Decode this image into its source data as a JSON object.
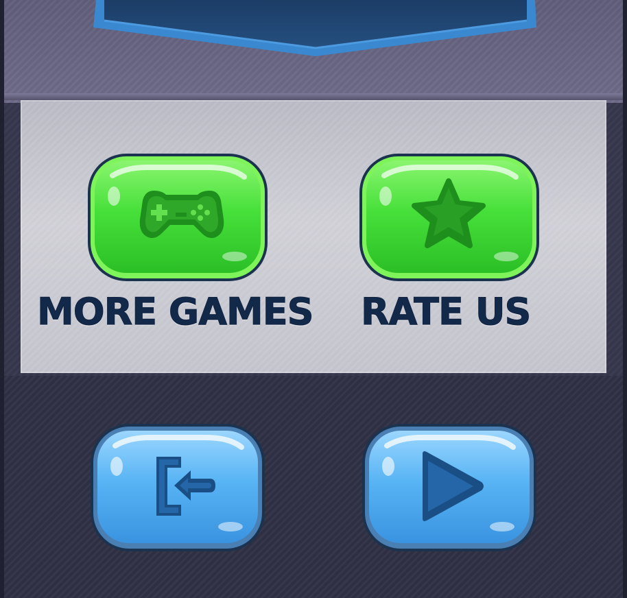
{
  "menu": {
    "more_games_label": "MORE GAMES",
    "rate_us_label": "RATE US"
  },
  "buttons": [
    {
      "name": "more-games-button",
      "icon": "gamepad-icon",
      "color": "#3fd83a"
    },
    {
      "name": "rate-us-button",
      "icon": "star-icon",
      "color": "#3fd83a"
    },
    {
      "name": "exit-button",
      "icon": "exit-icon",
      "color": "#4aa8ee"
    },
    {
      "name": "play-button",
      "icon": "play-icon",
      "color": "#4aa8ee"
    }
  ],
  "colors": {
    "label_text": "#13294a",
    "green_button": "#3fd83a",
    "blue_button": "#4aa8ee",
    "banner": "#1e4570"
  }
}
